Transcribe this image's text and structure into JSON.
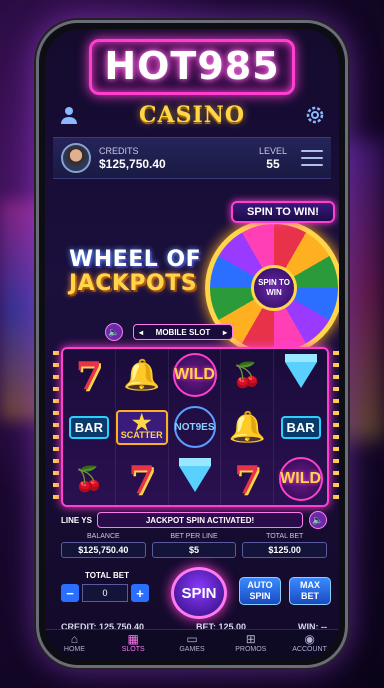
{
  "logo": "HOT985",
  "header": {
    "title": "CASINO"
  },
  "credits": {
    "label": "CREDITS",
    "value": "$125,750.40",
    "level_label": "LEVEL",
    "level_value": "55"
  },
  "promo": {
    "ribbon": "SPIN TO WIN!",
    "title_line1": "WHEEL OF",
    "title_line2": "JACKPOTS",
    "wheel_center": "SPIN TO WIN"
  },
  "slot": {
    "mode_label": "MOBILE SLOT",
    "prev_arrow": "◂",
    "next_arrow": "▸"
  },
  "reels": [
    [
      "seven",
      "bell",
      "wild",
      "cherry",
      "gem"
    ],
    [
      "bar",
      "scatter",
      "not",
      "bell",
      "bar"
    ],
    [
      "cherry",
      "seven",
      "gem",
      "seven",
      "wild"
    ]
  ],
  "symbols": {
    "wild": "WILD",
    "bar": "BAR",
    "scatter": "SCATTER",
    "not": "NOT9ES",
    "seven": "7",
    "bell": "🔔",
    "cherry": "🍒"
  },
  "lines": {
    "label": "LINE YS",
    "message": "JACKPOT SPIN ACTIVATED!"
  },
  "balances": [
    {
      "label": "BALANCE",
      "value": "$125,750.40"
    },
    {
      "label": "BET PER LINE",
      "value": "$5"
    },
    {
      "label": "TOTAL BET",
      "value": "$125.00"
    }
  ],
  "controls": {
    "total_bet_label": "TOTAL BET",
    "total_bet_value": "0",
    "minus": "−",
    "plus": "+",
    "spin": "SPIN",
    "auto_spin": "AUTO SPIN",
    "max_bet": "MAX BET"
  },
  "summary": {
    "credit": "CREDIT: 125,750.40",
    "bet": "BET: 125.00",
    "win": "WIN: --"
  },
  "nav": [
    {
      "label": "HOME",
      "icon": "⌂"
    },
    {
      "label": "SLOTS",
      "icon": "▦"
    },
    {
      "label": "GAMES",
      "icon": "▭"
    },
    {
      "label": "PROMOS",
      "icon": "⊞"
    },
    {
      "label": "ACCOUNT",
      "icon": "◉"
    }
  ],
  "colors": {
    "accent": "#ff3fd0",
    "gold": "#ffd54a",
    "blue": "#2a6fff"
  }
}
